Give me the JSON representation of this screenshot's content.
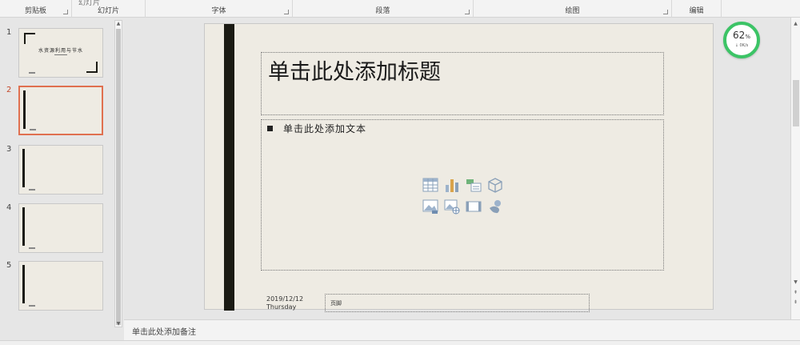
{
  "ribbon": {
    "groups": [
      {
        "label": "剪贴板"
      },
      {
        "label": "幻灯片"
      },
      {
        "label": "字体"
      },
      {
        "label": "段落"
      },
      {
        "label": "绘图"
      },
      {
        "label": "编辑"
      }
    ],
    "cut_text": "幻灯片"
  },
  "thumbnails": [
    {
      "number": "1",
      "title": "水资源利用与节水"
    },
    {
      "number": "2"
    },
    {
      "number": "3"
    },
    {
      "number": "4"
    },
    {
      "number": "5"
    }
  ],
  "slide": {
    "title_placeholder": "单击此处添加标题",
    "body_placeholder": "单击此处添加文本",
    "date": "2019/12/12",
    "weekday": "Thursday",
    "footer": "页脚"
  },
  "notes": {
    "placeholder": "单击此处添加备注"
  },
  "perf_widget": {
    "percent": "62",
    "percent_unit": "%",
    "speed": "0K/s"
  },
  "colors": {
    "accent_selected": "#e07050",
    "slide_bg": "#eeebe3",
    "dark_bar": "#1b1b14",
    "perf_ring": "#3cc466"
  }
}
